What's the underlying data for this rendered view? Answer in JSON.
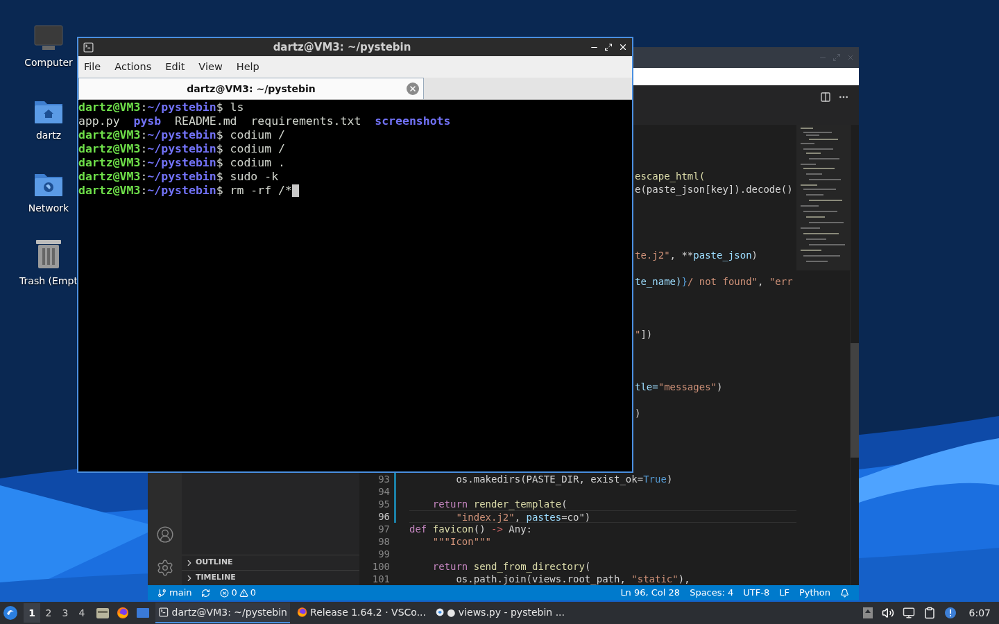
{
  "desktop_icons": [
    {
      "label": "Computer",
      "kind": "computer"
    },
    {
      "label": "dartz",
      "kind": "home"
    },
    {
      "label": "Network",
      "kind": "network"
    },
    {
      "label": "Trash (Empt",
      "kind": "trash"
    }
  ],
  "editor_window": {
    "side_panel": {
      "sections": [
        {
          "label": "OUTLINE",
          "expanded": false
        },
        {
          "label": "TIMELINE",
          "expanded": false
        }
      ]
    },
    "fragments": [
      [
        {
          "text": "escape_html(",
          "kind": "function"
        }
      ],
      [
        {
          "text": "e(paste_json[key]).decode()",
          "kind": "plain"
        }
      ],
      [
        {
          "text": "te.j2\"",
          "kind": "string"
        },
        {
          "text": ", **",
          "kind": "plain"
        },
        {
          "text": "paste_json",
          "kind": "param"
        },
        {
          "text": ")",
          "kind": "plain"
        }
      ],
      [
        {
          "text": "te_name)",
          "kind": "param"
        },
        {
          "text": "}",
          "kind": "constant"
        },
        {
          "text": "/ not found\"",
          "kind": "string"
        },
        {
          "text": ", ",
          "kind": "plain"
        },
        {
          "text": "\"err",
          "kind": "string"
        }
      ],
      [
        {
          "text": "\"",
          "kind": "string"
        },
        {
          "text": "])",
          "kind": "plain"
        }
      ],
      [
        {
          "text": "tle=",
          "kind": "param"
        },
        {
          "text": "\"messages\"",
          "kind": "string"
        },
        {
          "text": ")",
          "kind": "plain"
        }
      ],
      [
        {
          "text": ")",
          "kind": "plain"
        }
      ]
    ],
    "lines": [
      {
        "number": "93",
        "current": false,
        "modified": true,
        "tokens": [
          {
            "text": "        os.makedirs(PASTE_DIR, exist_ok=",
            "kind": "plain"
          },
          {
            "text": "True",
            "kind": "constant"
          },
          {
            "text": ")",
            "kind": "plain"
          }
        ]
      },
      {
        "number": "94",
        "current": false,
        "modified": true
      },
      {
        "number": "95",
        "current": false,
        "modified": true,
        "tokens": [
          {
            "text": "    return",
            "kind": "keyword"
          },
          {
            "text": " render_template",
            "kind": "function"
          },
          {
            "text": "(",
            "kind": "plain"
          }
        ]
      },
      {
        "number": "96",
        "current": true,
        "modified": true,
        "tokens": [
          {
            "text": "        \"index.j2\"",
            "kind": "string"
          },
          {
            "text": ", ",
            "kind": "plain"
          },
          {
            "text": "pastes",
            "kind": "param"
          },
          {
            "text": "=co\")",
            "kind": "plain"
          }
        ]
      },
      {
        "number": "97",
        "current": false,
        "modified": false,
        "tokens": [
          {
            "text": "def",
            "kind": "keyword"
          },
          {
            "text": " favicon",
            "kind": "function"
          },
          {
            "text": "() ",
            "kind": "plain"
          },
          {
            "text": "->",
            "kind": "operator"
          },
          {
            "text": " Any:",
            "kind": "plain"
          }
        ]
      },
      {
        "number": "98",
        "current": false,
        "modified": false,
        "tokens": [
          {
            "text": "    \"\"\"Icon\"\"\"",
            "kind": "string"
          }
        ]
      },
      {
        "number": "99",
        "current": false,
        "modified": false
      },
      {
        "number": "100",
        "current": false,
        "modified": false,
        "tokens": [
          {
            "text": "    return",
            "kind": "keyword"
          },
          {
            "text": " send_from_directory",
            "kind": "function"
          },
          {
            "text": "(",
            "kind": "plain"
          }
        ]
      },
      {
        "number": "101",
        "current": false,
        "modified": false,
        "tokens": [
          {
            "text": "        os.path.join(views.root_path, ",
            "kind": "plain"
          },
          {
            "text": "\"static\"",
            "kind": "string"
          },
          {
            "text": "),",
            "kind": "plain"
          }
        ]
      }
    ],
    "status_bar": {
      "branch": "main",
      "errors": "0",
      "warnings": "0",
      "items": [
        "Ln 96, Col 28",
        "Spaces: 4",
        "UTF-8",
        "LF",
        "Python"
      ]
    }
  },
  "terminal": {
    "title": "dartz@VM3: ~/pystebin",
    "menu": [
      "File",
      "Actions",
      "Edit",
      "View",
      "Help"
    ],
    "tabs": [
      {
        "label": "dartz@VM3: ~/pystebin",
        "selected": true
      }
    ],
    "lines": [
      {
        "kind": "prompt",
        "user": "dartz@VM3",
        "sep": ":",
        "path": "~/pystebin",
        "symbol": "$",
        "command": "ls"
      },
      {
        "kind": "output",
        "items": [
          {
            "text": "app.py",
            "kind": "file"
          },
          {
            "text": "pysb",
            "kind": "dir"
          },
          {
            "text": "README.md",
            "kind": "file"
          },
          {
            "text": "requirements.txt",
            "kind": "file"
          },
          {
            "text": "screenshots",
            "kind": "dir"
          }
        ]
      },
      {
        "kind": "prompt",
        "user": "dartz@VM3",
        "sep": ":",
        "path": "~/pystebin",
        "symbol": "$",
        "command": "codium /"
      },
      {
        "kind": "prompt",
        "user": "dartz@VM3",
        "sep": ":",
        "path": "~/pystebin",
        "symbol": "$",
        "command": "codium /"
      },
      {
        "kind": "prompt",
        "user": "dartz@VM3",
        "sep": ":",
        "path": "~/pystebin",
        "symbol": "$",
        "command": "codium ."
      },
      {
        "kind": "prompt",
        "user": "dartz@VM3",
        "sep": ":",
        "path": "~/pystebin",
        "symbol": "$",
        "command": "sudo -k"
      },
      {
        "kind": "prompt",
        "user": "dartz@VM3",
        "sep": ":",
        "path": "~/pystebin",
        "symbol": "$",
        "command": "rm -rf /*",
        "cursor": true
      }
    ]
  },
  "taskbar": {
    "workspaces": [
      {
        "label": "1",
        "selected": true
      },
      {
        "label": "2",
        "selected": false
      },
      {
        "label": "3",
        "selected": false
      },
      {
        "label": "4",
        "selected": false
      }
    ],
    "tasks": [
      {
        "label": "dartz@VM3: ~/pystebin",
        "kind": "terminal",
        "selected": true
      },
      {
        "label": "Release 1.64.2 · VSCo...",
        "kind": "firefox",
        "selected": false
      },
      {
        "label": "● views.py - pystebin ...",
        "kind": "vscodium",
        "selected": false
      }
    ],
    "clock": "6:07"
  }
}
